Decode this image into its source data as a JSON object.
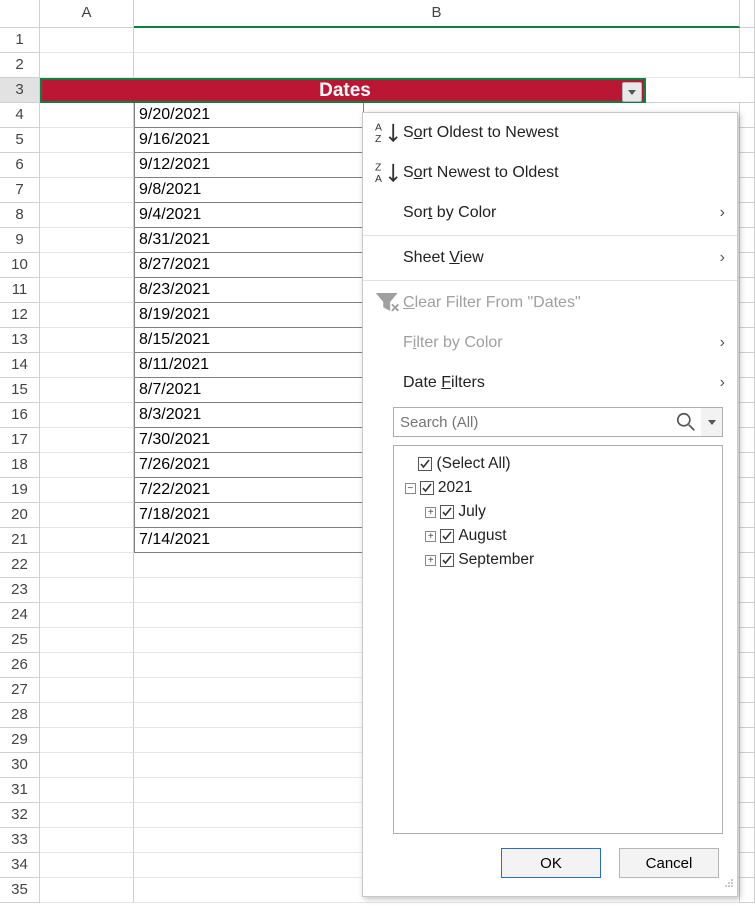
{
  "columns": {
    "A": "A",
    "B": "B"
  },
  "header_cell": "Dates",
  "rows": [
    {
      "n": "1",
      "v": ""
    },
    {
      "n": "2",
      "v": ""
    },
    {
      "n": "3",
      "v": "__HDR__"
    },
    {
      "n": "4",
      "v": "9/20/2021"
    },
    {
      "n": "5",
      "v": "9/16/2021"
    },
    {
      "n": "6",
      "v": "9/12/2021"
    },
    {
      "n": "7",
      "v": "9/8/2021"
    },
    {
      "n": "8",
      "v": "9/4/2021"
    },
    {
      "n": "9",
      "v": "8/31/2021"
    },
    {
      "n": "10",
      "v": "8/27/2021"
    },
    {
      "n": "11",
      "v": "8/23/2021"
    },
    {
      "n": "12",
      "v": "8/19/2021"
    },
    {
      "n": "13",
      "v": "8/15/2021"
    },
    {
      "n": "14",
      "v": "8/11/2021"
    },
    {
      "n": "15",
      "v": "8/7/2021"
    },
    {
      "n": "16",
      "v": "8/3/2021"
    },
    {
      "n": "17",
      "v": "7/30/2021"
    },
    {
      "n": "18",
      "v": "7/26/2021"
    },
    {
      "n": "19",
      "v": "7/22/2021"
    },
    {
      "n": "20",
      "v": "7/18/2021"
    },
    {
      "n": "21",
      "v": "7/14/2021"
    },
    {
      "n": "22",
      "v": ""
    },
    {
      "n": "23",
      "v": ""
    },
    {
      "n": "24",
      "v": ""
    },
    {
      "n": "25",
      "v": ""
    },
    {
      "n": "26",
      "v": ""
    },
    {
      "n": "27",
      "v": ""
    },
    {
      "n": "28",
      "v": ""
    },
    {
      "n": "29",
      "v": ""
    },
    {
      "n": "30",
      "v": ""
    },
    {
      "n": "31",
      "v": ""
    },
    {
      "n": "32",
      "v": ""
    },
    {
      "n": "33",
      "v": ""
    },
    {
      "n": "34",
      "v": ""
    },
    {
      "n": "35",
      "v": ""
    }
  ],
  "menu": {
    "sort_oldest_pre": "S",
    "sort_oldest_u": "o",
    "sort_oldest_post": "rt Oldest to Newest",
    "sort_newest_pre": "S",
    "sort_newest_u": "o",
    "sort_newest_post": "rt Newest to Oldest",
    "sort_color_pre": "Sor",
    "sort_color_u": "t",
    "sort_color_post": " by Color",
    "sheet_view_pre": "Sheet ",
    "sheet_view_u": "V",
    "sheet_view_post": "iew",
    "clear_filter_pre": "",
    "clear_filter_u": "C",
    "clear_filter_post": "lear Filter From \"Dates\"",
    "filter_color_pre": "F",
    "filter_color_u": "i",
    "filter_color_post": "lter by Color",
    "date_filters_pre": "Date ",
    "date_filters_u": "F",
    "date_filters_post": "ilters",
    "search_placeholder": "Search (All)",
    "tree": {
      "select_all": "(Select All)",
      "year": "2021",
      "months": [
        "July",
        "August",
        "September"
      ]
    },
    "ok": "OK",
    "cancel": "Cancel"
  }
}
